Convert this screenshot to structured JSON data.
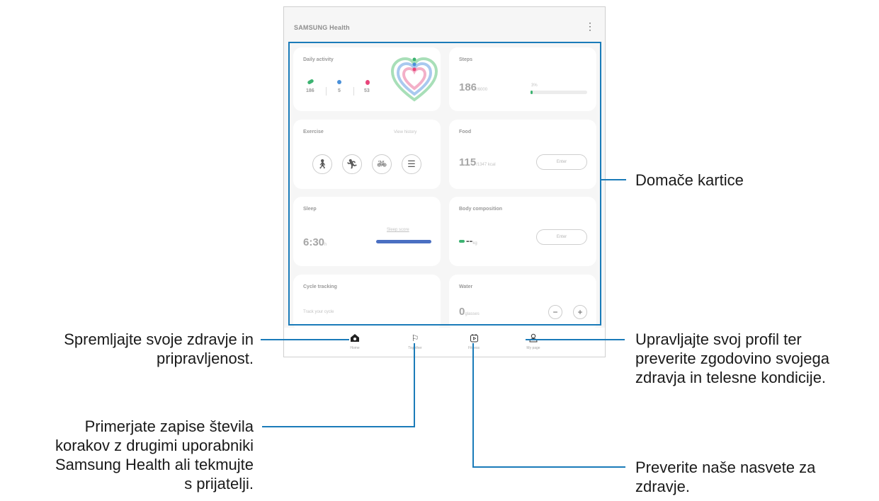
{
  "app": {
    "title": "SAMSUNG Health",
    "more_icon": "more-vert-icon"
  },
  "cards": {
    "daily_activity": {
      "title": "Daily activity",
      "steps": "186",
      "minutes": "5",
      "calories": "53"
    },
    "steps": {
      "title": "Steps",
      "value": "186",
      "unit": "/6000",
      "percent_label": "3%",
      "progress": 0.03
    },
    "exercise": {
      "title": "Exercise",
      "link": "View history",
      "buttons": [
        "walking-icon",
        "running-icon",
        "cycling-icon",
        "list-icon"
      ]
    },
    "food": {
      "title": "Food",
      "value": "115",
      "unit": "/1347 kcal",
      "button": "Enter"
    },
    "sleep": {
      "title": "Sleep",
      "value": "6:30",
      "unit": "h",
      "detail": "Sleep score"
    },
    "body_composition": {
      "title": "Body composition",
      "value": "--",
      "unit": "kg",
      "button": "Enter"
    },
    "cycle_tracking": {
      "title": "Cycle tracking",
      "prompt": "Track your cycle"
    },
    "water": {
      "title": "Water",
      "value": "0",
      "unit": "glasses",
      "minus": "−",
      "plus": "+"
    }
  },
  "nav": [
    {
      "label": "Home",
      "icon": "home-icon",
      "active": true
    },
    {
      "label": "Together",
      "icon": "flag-icon",
      "active": false
    },
    {
      "label": "Fitness",
      "icon": "fitness-icon",
      "active": false
    },
    {
      "label": "My page",
      "icon": "person-icon",
      "active": false
    }
  ],
  "callouts": {
    "home_cards": "Domače kartice",
    "home_tab_1": "Spremljajte svoje zdravje in",
    "home_tab_2": "pripravljenost.",
    "together_1": "Primerjate zapise števila",
    "together_2": "korakov z drugimi uporabniki",
    "together_3": "Samsung Health ali tekmujte",
    "together_4": "s prijatelji.",
    "mypage_1": "Upravljajte svoj profil ter",
    "mypage_2": "preverite zgodovino svojega",
    "mypage_3": "zdravja in telesne kondicije.",
    "fitness_1": "Preverite naše nasvete za",
    "fitness_2": "zdravje."
  },
  "colors": {
    "accent": "#1a7bb9",
    "steps_green": "#3cb371",
    "sleep_blue": "#4a6fc2"
  }
}
